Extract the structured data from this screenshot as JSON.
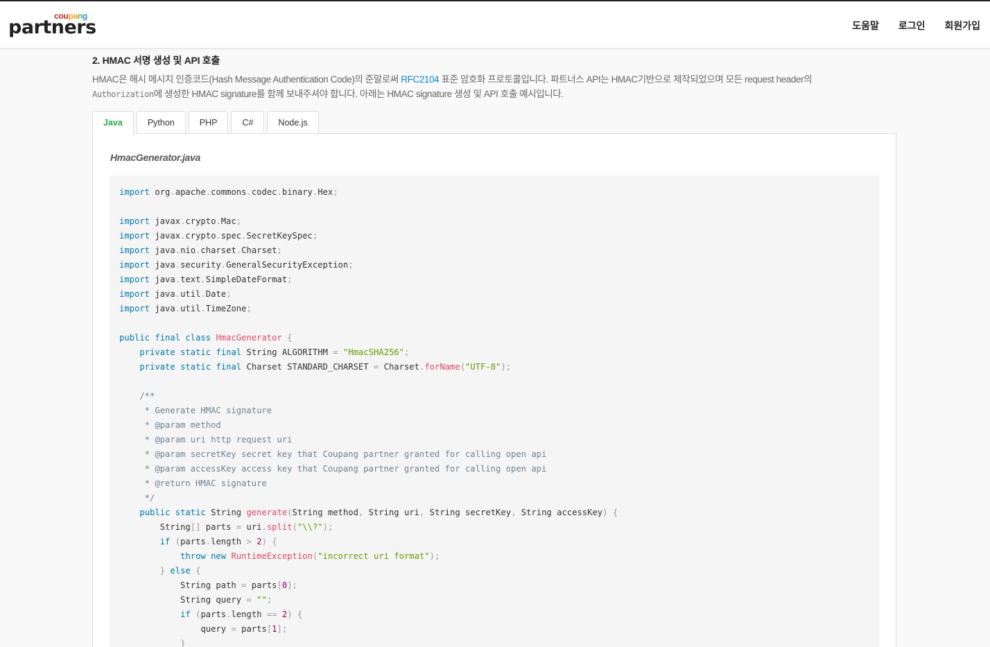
{
  "header": {
    "logo_top": "coupang",
    "logo_main": "partners",
    "nav": [
      "도움말",
      "로그인",
      "회원가입"
    ]
  },
  "content": {
    "section_title": "2. HMAC 서명 생성 및 API 호출",
    "desc_part1": "HMAC은 해시 메시지 인증코드(Hash Message Authentication Code)의 준말로써 ",
    "desc_link": "RFC2104",
    "desc_part2": " 표준 암호화 프로토콜입니다. 파트너스 API는 HMAC기반으로 제작되었으며 모든 request header의 ",
    "desc_code": "Authorization",
    "desc_part3": "에 생성한 HMAC signature를 함께 보내주셔야 합니다. 아래는 HMAC signature 생성 및 API 호출 예시입니다.",
    "tabs": [
      "Java",
      "Python",
      "PHP",
      "C#",
      "Node.js"
    ],
    "active_tab": "Java",
    "file_name": "HmacGenerator.java"
  },
  "colors": {
    "brand_green": "#2aa94b",
    "link_blue": "#0f84d6",
    "keyword": "#0077aa",
    "string": "#669900",
    "function": "#dd4a68",
    "comment": "#708090",
    "number": "#990055"
  },
  "code_lines": [
    "import org.apache.commons.codec.binary.Hex;",
    "",
    "import javax.crypto.Mac;",
    "import javax.crypto.spec.SecretKeySpec;",
    "import java.nio.charset.Charset;",
    "import java.security.GeneralSecurityException;",
    "import java.text.SimpleDateFormat;",
    "import java.util.Date;",
    "import java.util.TimeZone;",
    "",
    "public final class HmacGenerator {",
    "    private static final String ALGORITHM = \"HmacSHA256\";",
    "    private static final Charset STANDARD_CHARSET = Charset.forName(\"UTF-8\");",
    "",
    "    /**",
    "     * Generate HMAC signature",
    "     * @param method",
    "     * @param uri http request uri",
    "     * @param secretKey secret key that Coupang partner granted for calling open api",
    "     * @param accessKey access key that Coupang partner granted for calling open api",
    "     * @return HMAC signature",
    "     */",
    "    public static String generate(String method, String uri, String secretKey, String accessKey) {",
    "        String[] parts = uri.split(\"\\\\?\");",
    "        if (parts.length > 2) {",
    "            throw new RuntimeException(\"incorrect uri format\");",
    "        } else {",
    "            String path = parts[0];",
    "            String query = \"\";",
    "            if (parts.length == 2) {",
    "                query = parts[1];",
    "            }"
  ]
}
